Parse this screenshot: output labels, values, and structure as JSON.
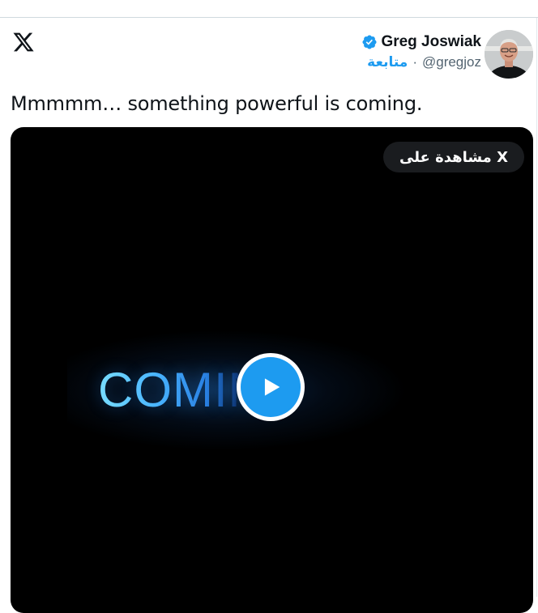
{
  "tweet": {
    "author": {
      "display_name": "Greg Joswiak",
      "handle": "@gregjoz",
      "follow_label": "متابعة",
      "separator": "·",
      "verified": true
    },
    "text": "Mmmmm… something powerful is coming.",
    "media": {
      "type": "video",
      "watch_label": "مشاهدة على X",
      "frame_text": "COMIN"
    }
  },
  "icons": {
    "logo": "x-logo-icon",
    "verified": "verified-badge-icon",
    "play": "play-icon"
  },
  "colors": {
    "accent": "#1d9bf0",
    "text": "#0f1419",
    "muted": "#536471",
    "media_bg": "#000000"
  }
}
